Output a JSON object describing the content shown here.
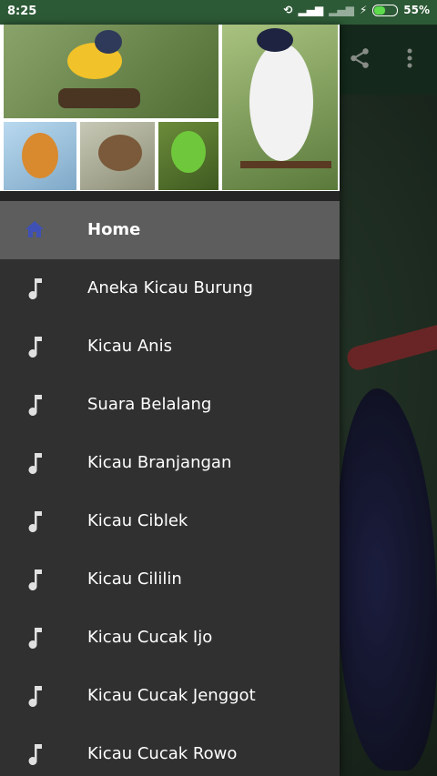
{
  "status_bar": {
    "time": "8:25",
    "battery_percent": "55%"
  },
  "drawer": {
    "items": [
      {
        "label": "Home",
        "icon": "home-icon",
        "active": true
      },
      {
        "label": "Aneka Kicau Burung",
        "icon": "music-note-icon"
      },
      {
        "label": "Kicau Anis",
        "icon": "music-note-icon"
      },
      {
        "label": "Suara Belalang",
        "icon": "music-note-icon"
      },
      {
        "label": "Kicau Branjangan",
        "icon": "music-note-icon"
      },
      {
        "label": "Kicau Ciblek",
        "icon": "music-note-icon"
      },
      {
        "label": "Kicau Cililin",
        "icon": "music-note-icon"
      },
      {
        "label": "Kicau Cucak Ijo",
        "icon": "music-note-icon"
      },
      {
        "label": "Kicau Cucak Jenggot",
        "icon": "music-note-icon"
      },
      {
        "label": "Kicau Cucak Rowo",
        "icon": "music-note-icon"
      }
    ]
  },
  "colors": {
    "status_bar": "#2d5a36",
    "drawer_bg": "#303030",
    "active_item_bg": "#5d5d5d",
    "home_icon": "#3f51b5",
    "music_icon": "#e0e0e0"
  }
}
